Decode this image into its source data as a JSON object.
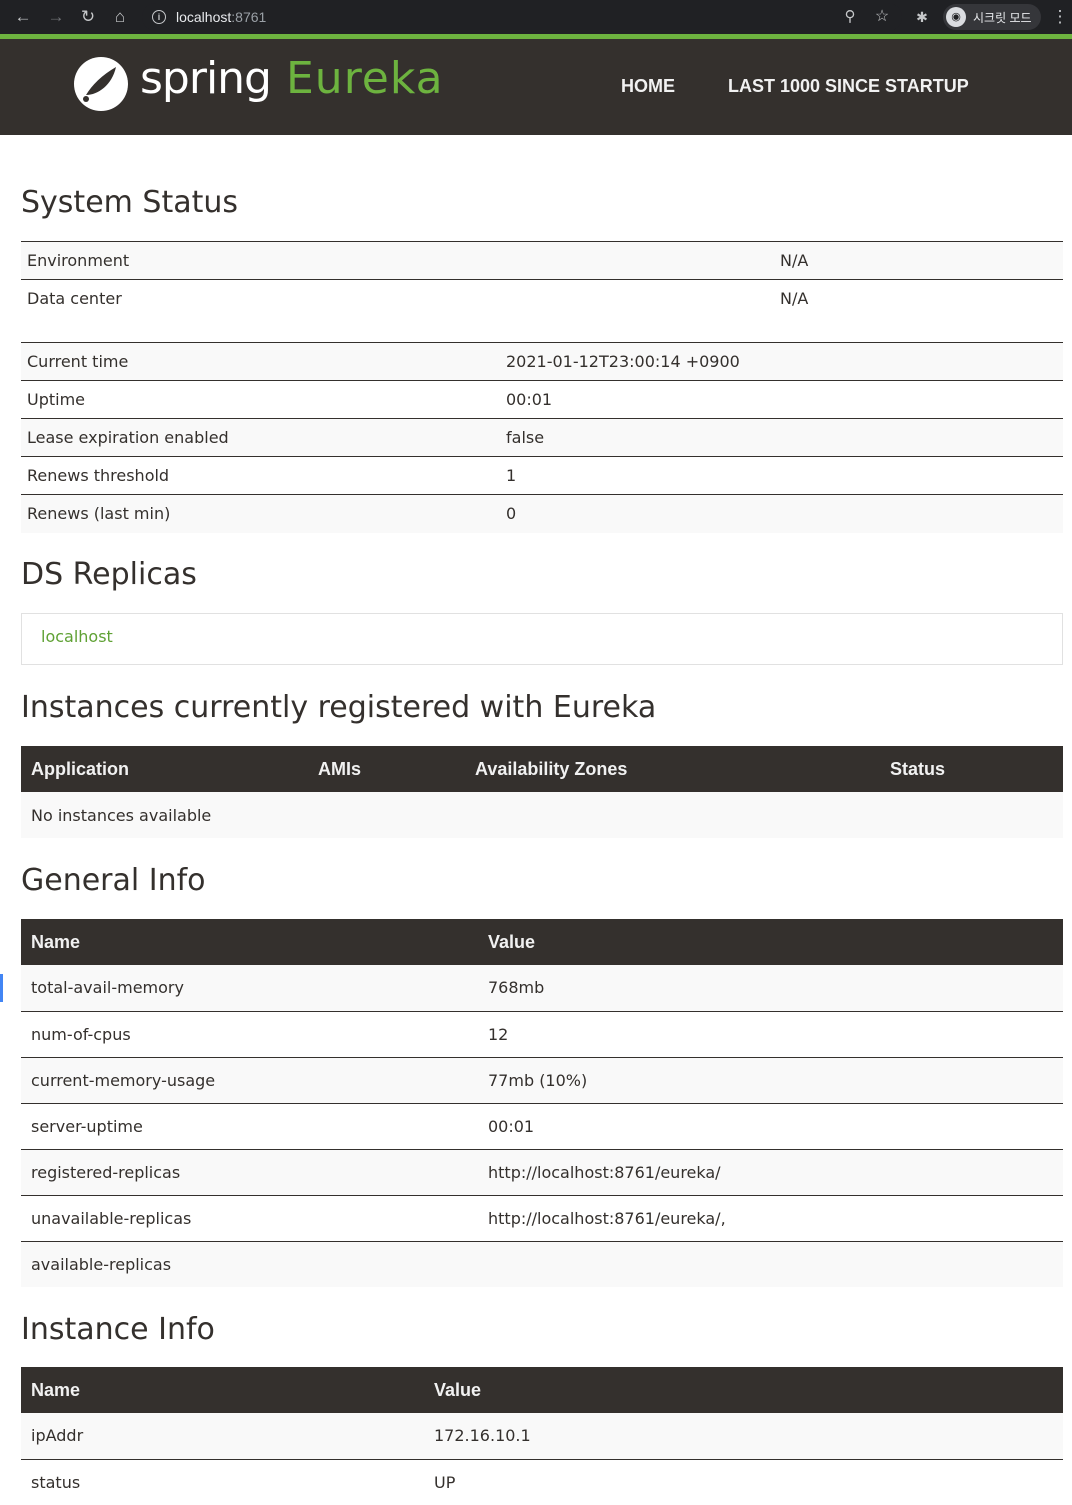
{
  "browser": {
    "url_host": "localhost",
    "url_port": ":8761",
    "incognito_label": "시크릿 모드"
  },
  "header": {
    "logo_spring": "spring",
    "logo_eureka": "Eureka",
    "nav": [
      "HOME",
      "LAST 1000 SINCE STARTUP"
    ]
  },
  "system_status": {
    "title": "System Status",
    "env_rows": [
      {
        "label": "Environment",
        "value": "N/A"
      },
      {
        "label": "Data center",
        "value": "N/A"
      }
    ],
    "runtime_rows": [
      {
        "label": "Current time",
        "value": "2021-01-12T23:00:14 +0900"
      },
      {
        "label": "Uptime",
        "value": "00:01"
      },
      {
        "label": "Lease expiration enabled",
        "value": "false"
      },
      {
        "label": "Renews threshold",
        "value": "1"
      },
      {
        "label": "Renews (last min)",
        "value": "0"
      }
    ]
  },
  "ds_replicas": {
    "title": "DS Replicas",
    "items": [
      "localhost"
    ]
  },
  "instances": {
    "title": "Instances currently registered with Eureka",
    "columns": [
      "Application",
      "AMIs",
      "Availability Zones",
      "Status"
    ],
    "empty_message": "No instances available"
  },
  "general_info": {
    "title": "General Info",
    "columns": [
      "Name",
      "Value"
    ],
    "rows": [
      {
        "name": "total-avail-memory",
        "value": "768mb"
      },
      {
        "name": "num-of-cpus",
        "value": "12"
      },
      {
        "name": "current-memory-usage",
        "value": "77mb (10%)"
      },
      {
        "name": "server-uptime",
        "value": "00:01"
      },
      {
        "name": "registered-replicas",
        "value": "http://localhost:8761/eureka/"
      },
      {
        "name": "unavailable-replicas",
        "value": "http://localhost:8761/eureka/,"
      },
      {
        "name": "available-replicas",
        "value": ""
      }
    ]
  },
  "instance_info": {
    "title": "Instance Info",
    "columns": [
      "Name",
      "Value"
    ],
    "rows": [
      {
        "name": "ipAddr",
        "value": "172.16.10.1"
      },
      {
        "name": "status",
        "value": "UP"
      }
    ]
  }
}
